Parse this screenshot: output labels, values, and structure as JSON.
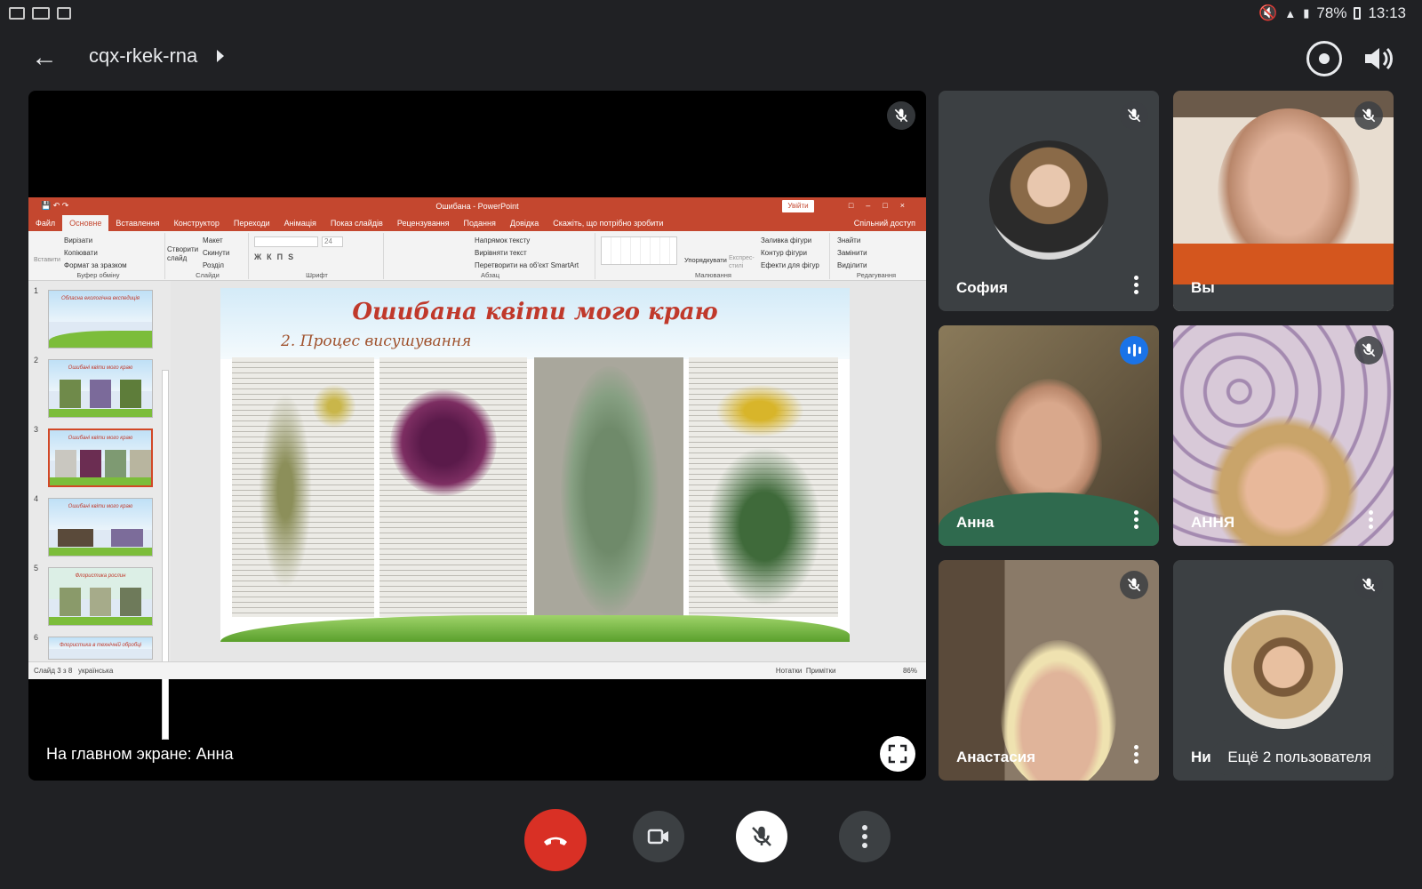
{
  "status_bar": {
    "battery": "78%",
    "time": "13:13"
  },
  "header": {
    "meeting_code": "cqx-rkek-rna",
    "back_icon": "arrow-back-icon",
    "switch_camera_icon": "switch-camera-icon",
    "audio_icon": "volume-icon"
  },
  "stage": {
    "label": "На главном экране: Анна",
    "mic_state_icon": "mic-off-icon",
    "fullscreen_icon": "fullscreen-icon"
  },
  "presentation": {
    "window_title": "Ошибана - PowerPoint",
    "exit_button": "Увійти",
    "tabs": [
      "Файл",
      "Основне",
      "Вставлення",
      "Конструктор",
      "Переходи",
      "Анімація",
      "Показ слайдів",
      "Рецензування",
      "Подання",
      "Довідка",
      "Скажіть, що потрібно зробити"
    ],
    "active_tab": "Основне",
    "share": "Спільний доступ",
    "ribbon": {
      "clipboard": {
        "label": "Буфер обміну",
        "items": [
          "Вирізати",
          "Копіювати",
          "Формат за зразком"
        ],
        "paste": "Вставити"
      },
      "slides": {
        "label": "Слайди",
        "items": [
          "Макет",
          "Скинути",
          "Розділ"
        ],
        "new_slide": "Створити слайд"
      },
      "font": {
        "label": "Шрифт",
        "size": "24"
      },
      "paragraph": {
        "label": "Абзац",
        "items": [
          "Напрямок тексту",
          "Вирівняти текст",
          "Перетворити на об'єкт SmartArt"
        ]
      },
      "drawing": {
        "label": "Малювання",
        "arrange": "Упорядкувати",
        "quick_styles": "Експрес-стилі",
        "items": [
          "Заливка фігури",
          "Контур фігури",
          "Ефекти для фігур"
        ]
      },
      "editing": {
        "label": "Редагування",
        "items": [
          "Знайти",
          "Замінити",
          "Виділити"
        ]
      }
    },
    "thumbnails": [
      {
        "num": "1",
        "title": "Обласна екологічна експедиція"
      },
      {
        "num": "2",
        "title": "Ошибані квіти мого краю"
      },
      {
        "num": "3",
        "title": "Ошибані квіти мого краю"
      },
      {
        "num": "4",
        "title": "Ошибані квіти мого краю"
      },
      {
        "num": "5",
        "title": "Флористика рослин"
      },
      {
        "num": "6",
        "title": "Флористика в технічній обробці"
      }
    ],
    "selected_slide": "3",
    "slide": {
      "title": "Ошибана квіти мого краю",
      "subtitle": "2. Процес висушування"
    },
    "status": {
      "slide_info": "Слайд 3 з 8",
      "language": "українська",
      "notes": "Нотатки",
      "comments": "Примітки",
      "zoom": "86%"
    }
  },
  "participants": [
    {
      "name": "София",
      "muted": true,
      "has_avatar": true
    },
    {
      "name": "Вы",
      "muted": true,
      "has_avatar": false
    },
    {
      "name": "Анна",
      "muted": false,
      "speaking": true,
      "has_avatar": false
    },
    {
      "name": "АННЯ",
      "muted": true,
      "has_avatar": false
    },
    {
      "name": "Анастасия",
      "muted": true,
      "has_avatar": false
    },
    {
      "name": "Ни",
      "muted": true,
      "has_avatar": true
    }
  ],
  "more_participants": "Ещё 2 пользователя",
  "controls": {
    "end_call_icon": "end-call-icon",
    "camera_icon": "videocam-icon",
    "mic_icon": "mic-off-icon",
    "more_icon": "more-vert-icon"
  },
  "colors": {
    "background": "#202124",
    "tile": "#3c4043",
    "end_call": "#d93025",
    "speaking": "#1a73e8",
    "ppt_accent": "#c4472f",
    "slide_title": "#c0392b"
  }
}
